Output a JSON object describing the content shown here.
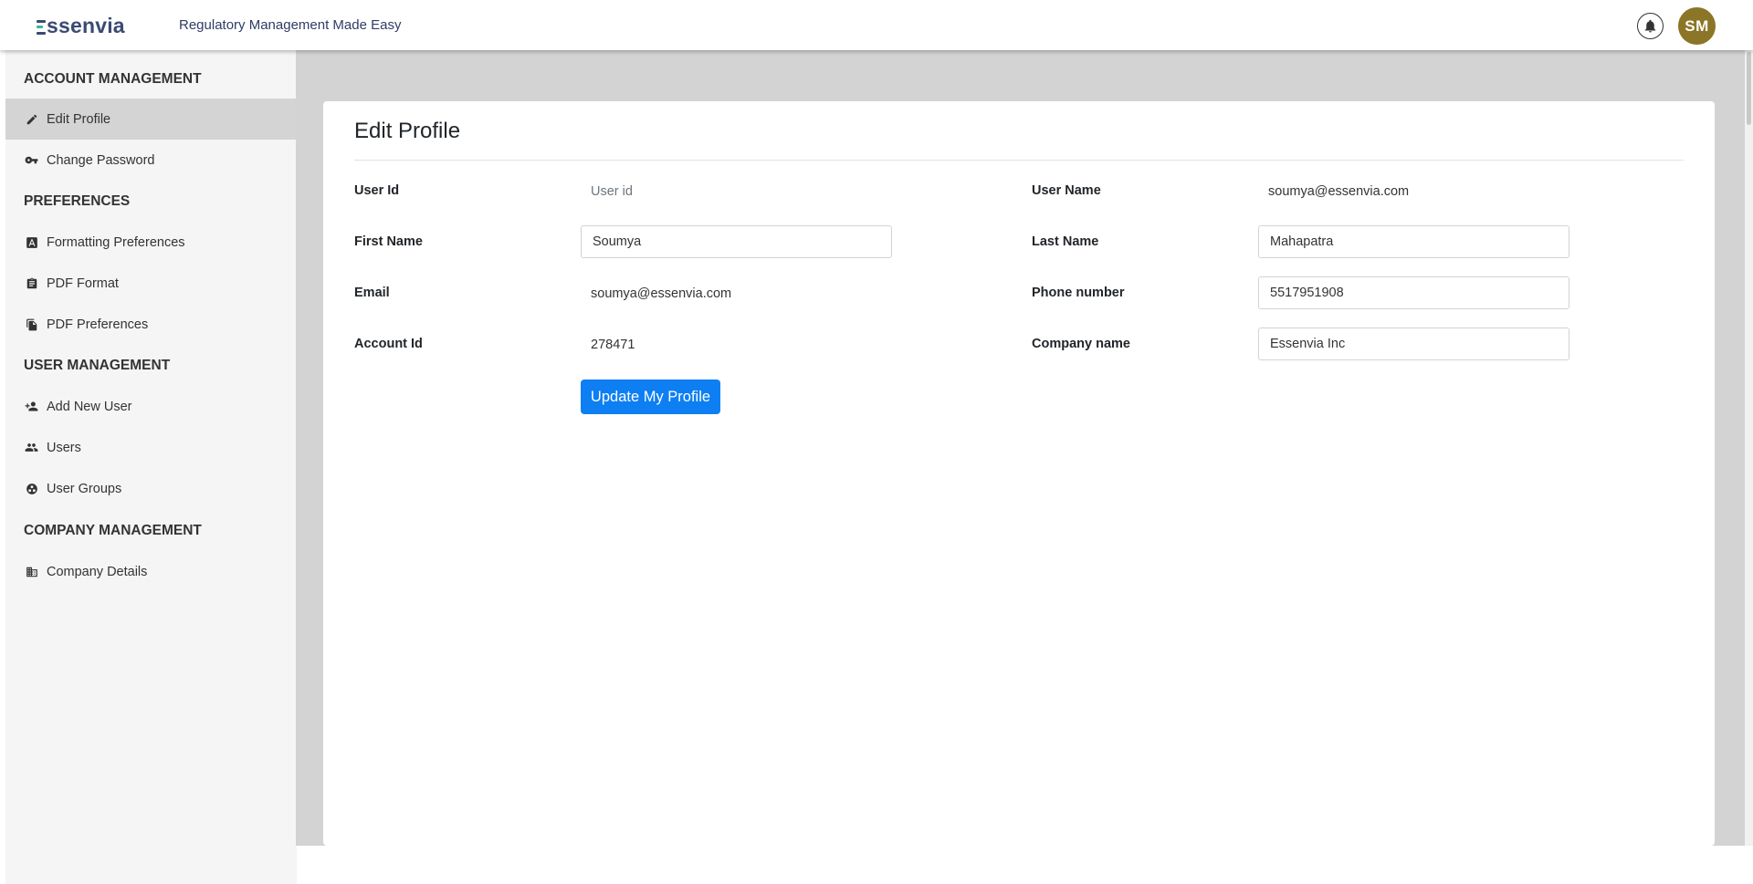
{
  "header": {
    "logo_text": "ssenvia",
    "tagline": "Regulatory Management Made Easy",
    "avatar_initials": "SM",
    "icons": [
      "bell-icon"
    ],
    "colors": {
      "avatar": "#8b7526",
      "brand": "#3a4a72",
      "brand_accent": "#3db39e"
    }
  },
  "sidebar": {
    "sections": [
      {
        "title": "ACCOUNT MANAGEMENT"
      },
      {
        "title": "PREFERENCES"
      },
      {
        "title": "USER MANAGEMENT"
      },
      {
        "title": "COMPANY MANAGEMENT"
      }
    ],
    "items": [
      {
        "label": "Edit Profile",
        "icon": "pencil-icon",
        "active": true
      },
      {
        "label": "Change Password",
        "icon": "key-icon"
      },
      {
        "label": "Formatting Preferences",
        "icon": "font-icon"
      },
      {
        "label": "PDF Format",
        "icon": "clipboard-icon"
      },
      {
        "label": "PDF Preferences",
        "icon": "copy-icon"
      },
      {
        "label": "Add New User",
        "icon": "person-add-icon"
      },
      {
        "label": "Users",
        "icon": "people-icon"
      },
      {
        "label": "User Groups",
        "icon": "group-work-icon"
      },
      {
        "label": "Company Details",
        "icon": "building-icon"
      }
    ]
  },
  "form": {
    "title": "Edit Profile",
    "user_id": {
      "label": "User Id",
      "value": "",
      "placeholder": "User id"
    },
    "user_name": {
      "label": "User Name",
      "value": "soumya@essenvia.com"
    },
    "first_name": {
      "label": "First Name",
      "value": "Soumya"
    },
    "last_name": {
      "label": "Last Name",
      "value": "Mahapatra"
    },
    "email": {
      "label": "Email",
      "value": "soumya@essenvia.com"
    },
    "phone": {
      "label": "Phone number",
      "value": "5517951908"
    },
    "account_id": {
      "label": "Account Id",
      "value": "278471"
    },
    "company_name": {
      "label": "Company name",
      "value": "Essenvia Inc"
    },
    "submit_label": "Update My Profile",
    "colors": {
      "button": "#0d7ff2"
    }
  }
}
